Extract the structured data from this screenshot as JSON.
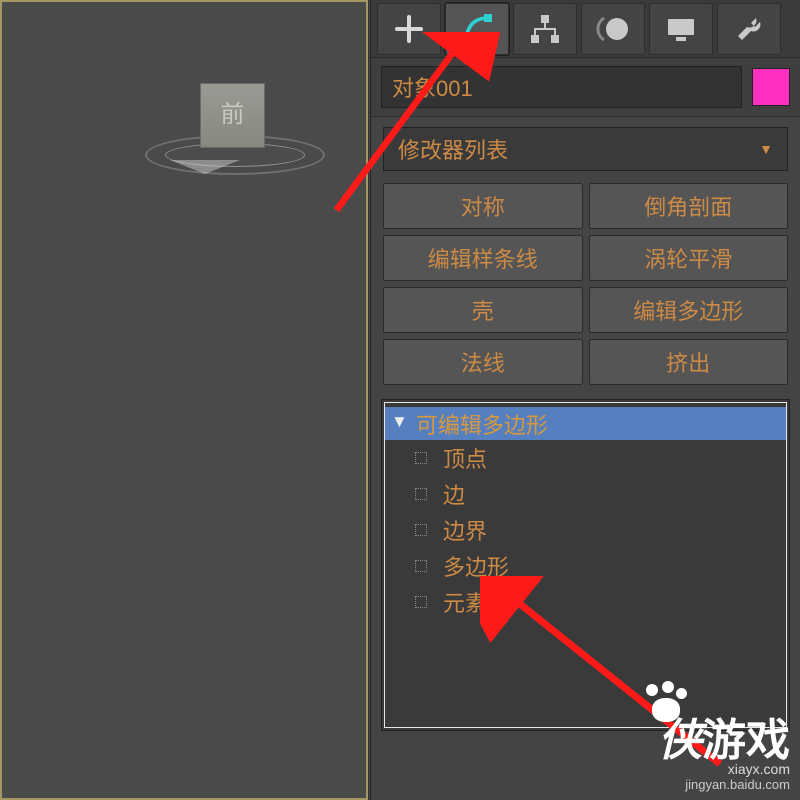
{
  "viewport": {
    "cube_face": "前"
  },
  "tabs": {
    "create": "create-tab",
    "modify": "modify-tab",
    "hierarchy": "hierarchy-tab",
    "motion": "motion-tab",
    "display": "display-tab",
    "utilities": "utilities-tab"
  },
  "object": {
    "name": "对象001",
    "swatch_color": "#ff2fbf"
  },
  "modifier_dropdown": {
    "label": "修改器列表"
  },
  "mod_buttons": {
    "symmetry": "对称",
    "chamfer_profile": "倒角剖面",
    "edit_spline": "编辑样条线",
    "turbosmooth": "涡轮平滑",
    "shell": "壳",
    "edit_poly": "编辑多边形",
    "normal": "法线",
    "extrude": "挤出"
  },
  "stack": {
    "root": "可编辑多边形",
    "children": [
      "顶点",
      "边",
      "边界",
      "多边形",
      "元素"
    ]
  },
  "watermark": {
    "big_left": "侠",
    "big_right": "游戏",
    "url": "xiayx.com",
    "sub": "jingyan.baidu.com"
  }
}
